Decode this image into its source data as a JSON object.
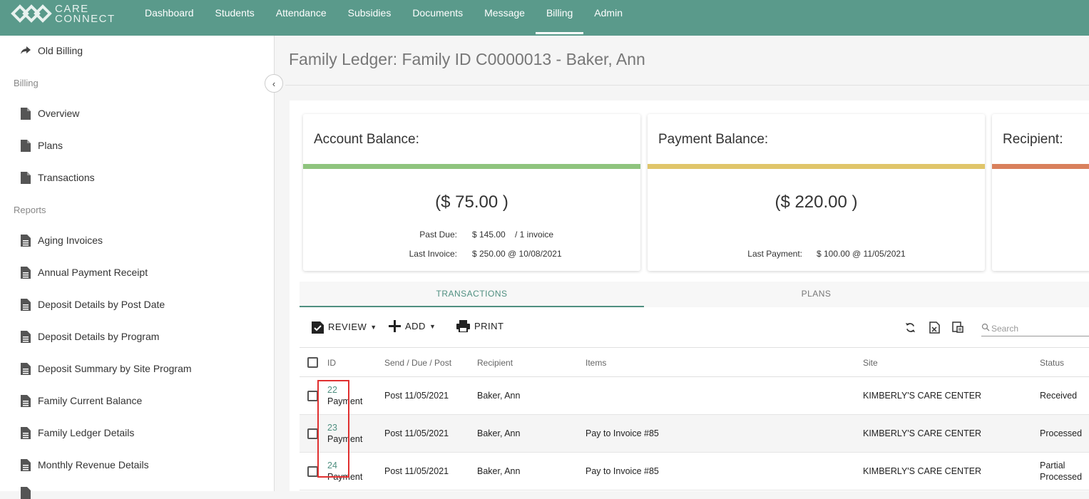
{
  "brand": {
    "line1": "CARE",
    "line2": "CONNECT"
  },
  "nav": [
    {
      "label": "Dashboard"
    },
    {
      "label": "Students"
    },
    {
      "label": "Attendance"
    },
    {
      "label": "Subsidies"
    },
    {
      "label": "Documents"
    },
    {
      "label": "Message"
    },
    {
      "label": "Billing"
    },
    {
      "label": "Admin"
    }
  ],
  "sidebar": {
    "old_billing": "Old Billing",
    "billing_section": "Billing",
    "billing_items": [
      "Overview",
      "Plans",
      "Transactions"
    ],
    "reports_section": "Reports",
    "report_items": [
      "Aging Invoices",
      "Annual Payment Receipt",
      "Deposit Details by Post Date",
      "Deposit Details by Program",
      "Deposit Summary by Site Program",
      "Family Current Balance",
      "Family Ledger Details",
      "Monthly Revenue Details"
    ]
  },
  "page": {
    "title": "Family Ledger: Family ID C0000013 - Baker, Ann"
  },
  "cards": {
    "account": {
      "title": "Account Balance:",
      "amount": "($ 75.00 )",
      "past_due_label": "Past Due:",
      "past_due_value": "$ 145.00",
      "past_due_count": "/ 1 invoice",
      "last_invoice_label": "Last Invoice:",
      "last_invoice_value": "$ 250.00 @ 10/08/2021",
      "color": "#8fc47e"
    },
    "payment": {
      "title": "Payment Balance:",
      "amount": "($ 220.00 )",
      "last_payment_label": "Last Payment:",
      "last_payment_value": "$ 100.00 @ 11/05/2021",
      "color": "#e0c56a"
    },
    "recipient": {
      "title": "Recipient:",
      "color": "#d9805c"
    }
  },
  "tabs": {
    "transactions": "TRANSACTIONS",
    "plans": "PLANS"
  },
  "toolbar": {
    "review": "REVIEW",
    "add": "ADD",
    "print": "PRINT",
    "search_placeholder": "Search"
  },
  "grid": {
    "headers": {
      "id": "ID",
      "dates": "Send / Due / Post",
      "recipient": "Recipient",
      "items": "Items",
      "site": "Site",
      "status": "Status"
    },
    "rows": [
      {
        "id": "22",
        "type": "Payment",
        "date": "Post 11/05/2021",
        "recipient": "Baker, Ann",
        "items": "",
        "site": "KIMBERLY'S CARE CENTER",
        "status": "Received",
        "status2": ""
      },
      {
        "id": "23",
        "type": "Payment",
        "date": "Post 11/05/2021",
        "recipient": "Baker, Ann",
        "items": "Pay to Invoice #85",
        "site": "KIMBERLY'S CARE CENTER",
        "status": "Processed",
        "status2": ""
      },
      {
        "id": "24",
        "type": "Payment",
        "date": "Post 11/05/2021",
        "recipient": "Baker, Ann",
        "items": "Pay to Invoice #85",
        "site": "KIMBERLY'S CARE CENTER",
        "status": "Partial",
        "status2": "Processed"
      }
    ]
  }
}
